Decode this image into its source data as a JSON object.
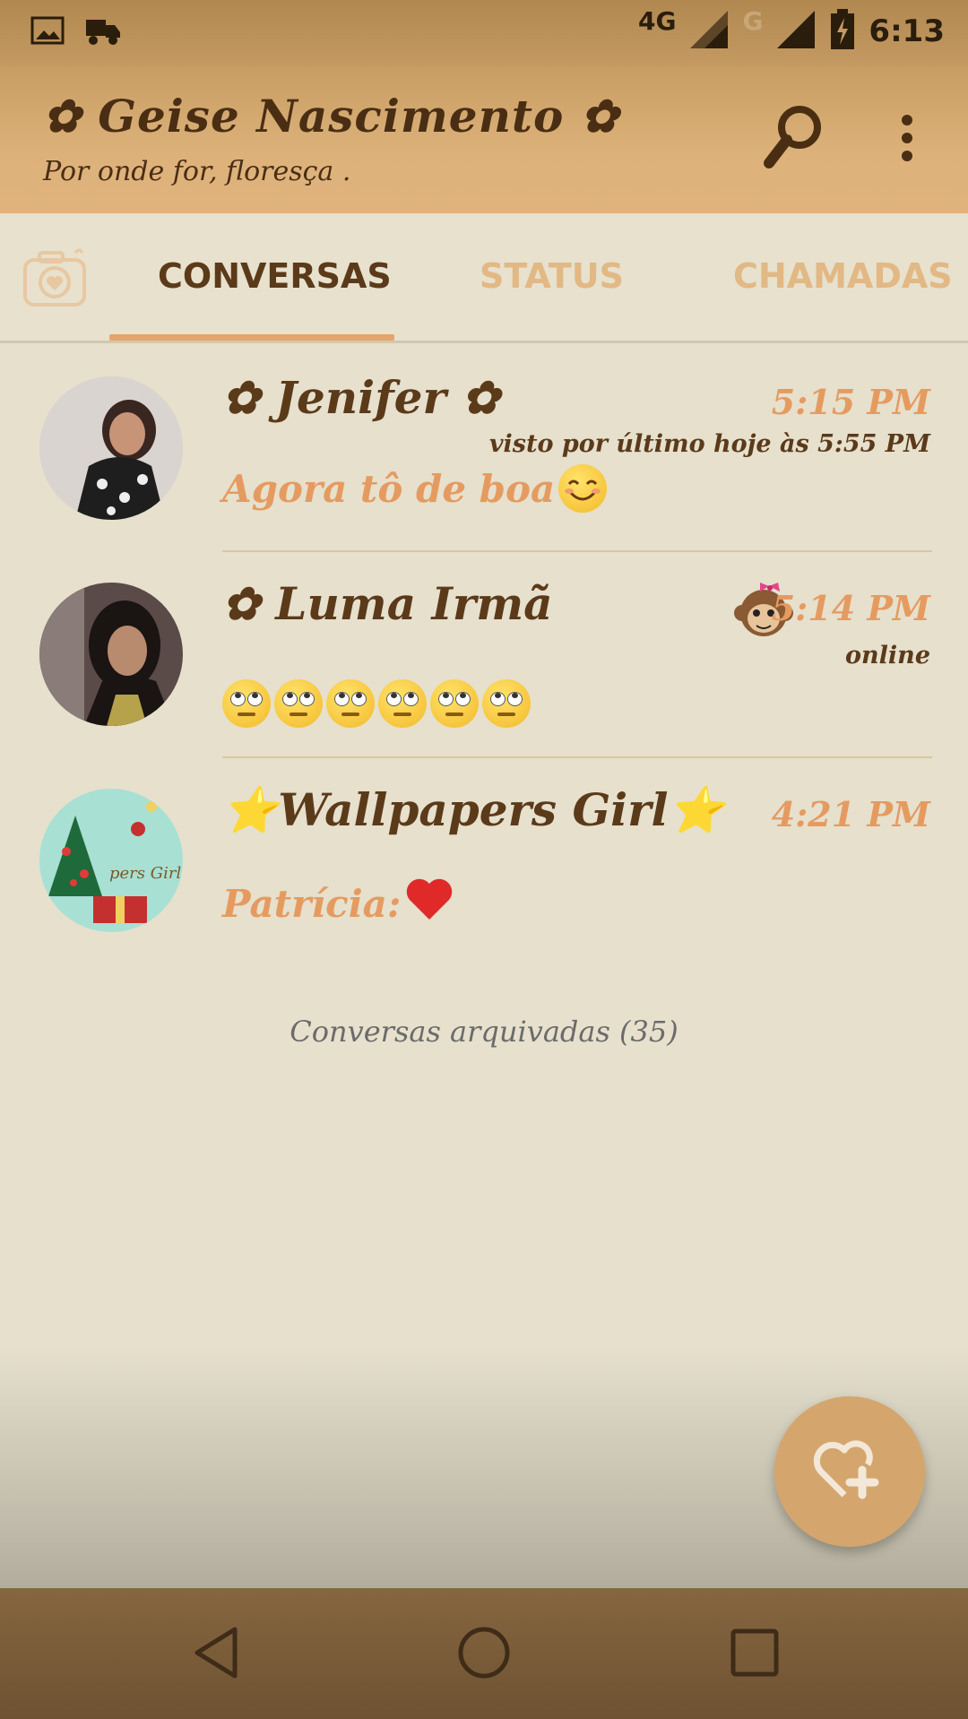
{
  "status_bar": {
    "network_primary": "4G",
    "network_secondary": "G",
    "time": "6:13",
    "icons": [
      "image-icon",
      "truck-icon",
      "signal-icon",
      "battery-charging-icon"
    ]
  },
  "app_bar": {
    "title": "✿ Geise Nascimento ✿",
    "subtitle": "Por onde for, floresça .",
    "icons": [
      "search-icon",
      "more-vert-icon"
    ]
  },
  "tabs": {
    "camera_icon": "camera-heart-icon",
    "items": [
      {
        "label": "CONVERSAS",
        "active": true
      },
      {
        "label": "STATUS",
        "active": false
      },
      {
        "label": "CHAMADAS",
        "active": false
      }
    ]
  },
  "chats": [
    {
      "name": "✿ Jenifer ✿",
      "time": "5:15 PM",
      "sub": "visto por último hoje às 5:55 PM",
      "message": "Agora tô de boa",
      "message_emoji": "smiling-face-emoji"
    },
    {
      "name": "✿ Luma Irmã",
      "time": "5:14 PM",
      "sub": "online",
      "message": "",
      "message_emoji": "eye-roll-emoji ×6",
      "badge": "monkey-emoji"
    },
    {
      "name": "⭐Wallpapers Girl⭐",
      "time": "4:21 PM",
      "sub": "",
      "message": "Patrícia: ",
      "message_emoji": "red-heart-emoji"
    }
  ],
  "archived_label": "Conversas arquivadas (35)",
  "fab": {
    "icon": "heart-plus-icon"
  },
  "nav": {
    "icons": [
      "back-icon",
      "home-icon",
      "recents-icon"
    ]
  },
  "colors": {
    "accent": "#e59b60",
    "primary": "#5b3a1a",
    "background": "#e6e0cd",
    "appbar": "#ddb27a"
  }
}
